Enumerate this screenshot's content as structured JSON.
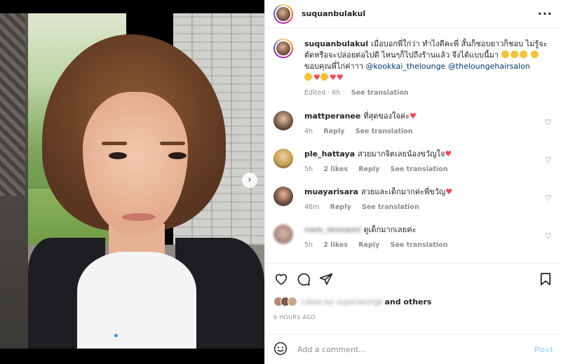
{
  "media": {
    "carousel_dots": 5,
    "active_dot": 0
  },
  "header": {
    "username": "suquanbulakul"
  },
  "caption": {
    "username": "suquanbulakul",
    "text_1": "เมื่อบอกพี่ใก่ว่า ทำไงดีคะพี่ สั้นก็ชอบยาวก็ชอบ ไม่รู้จะตัดหรือจะปล่อยต่อไปดี ไหนๆก็ไปถึงร้านแล้ว จึงได้แบบนี้มา",
    "text_2": "ขอบคุณพี่ไก่ค่าาา",
    "mention_1": "@kookkai_thelounge",
    "mention_2": "@theloungehairsalon",
    "edited": "Edited · 6h",
    "see_translation": "See translation"
  },
  "comments": [
    {
      "username": "mattperanee",
      "text": "ที่สุดของใจค่ะ",
      "time": "4h",
      "likes": "",
      "reply": "Reply",
      "translation": "See translation"
    },
    {
      "username": "ple_hattaya",
      "text": "สวยมากจิตเลยน้องขวัญใจ",
      "time": "5h",
      "likes": "2 likes",
      "reply": "Reply",
      "translation": "See translation"
    },
    {
      "username": "muayarisara",
      "text": "สวยและเด็กมากค่ะพี่ขวัญ",
      "time": "46m",
      "likes": "",
      "reply": "Reply",
      "translation": "See translation"
    },
    {
      "username": "nam_lensami",
      "text": "ดูเด็กมากเลยค่ะ",
      "time": "5h",
      "likes": "2 likes",
      "reply": "Reply",
      "translation": "See translation"
    }
  ],
  "likes": {
    "liked_by": "Liked by superwongk",
    "and_others": "and others"
  },
  "timestamp": "6 HOURS AGO",
  "add_comment": {
    "placeholder": "Add a comment...",
    "post_label": "Post"
  },
  "colors": {
    "accent": "#3897f0",
    "heart": "#ed4956",
    "mention": "#00376b",
    "post_disabled": "#b2dffc"
  }
}
